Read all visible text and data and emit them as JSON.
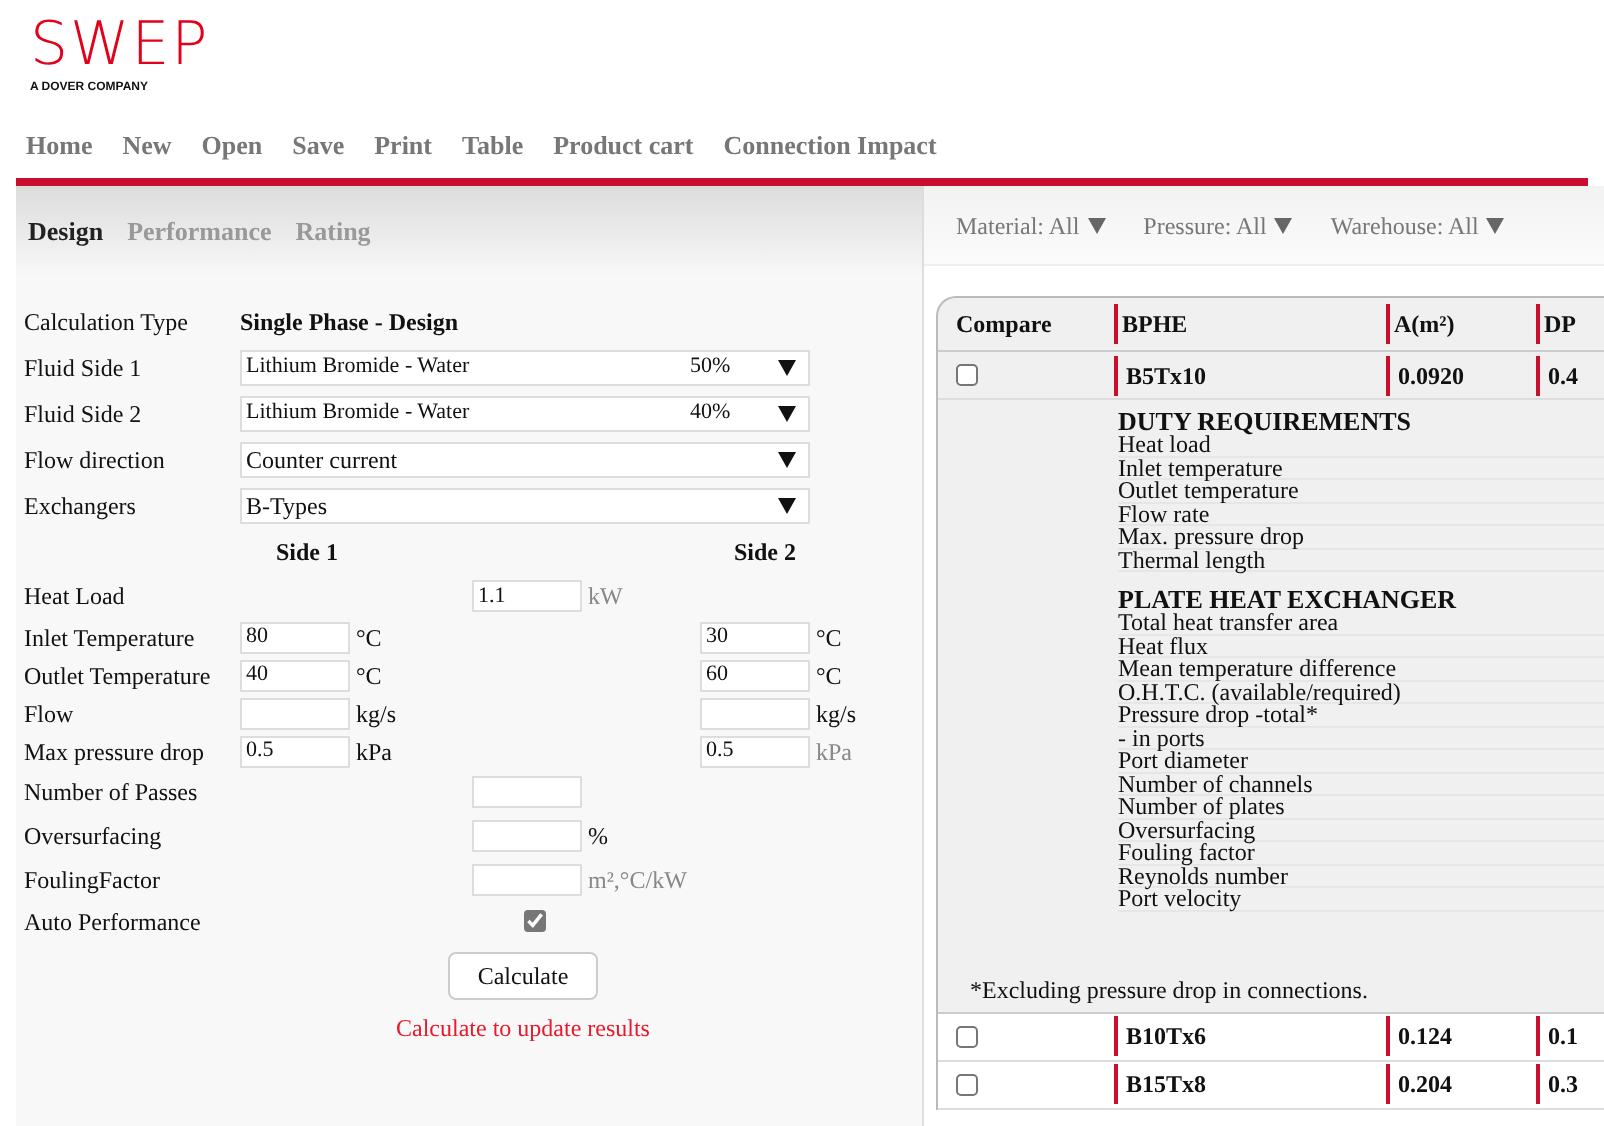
{
  "logo": {
    "name": "SWEP",
    "tagline": "A DOVER COMPANY"
  },
  "nav": [
    "Home",
    "New",
    "Open",
    "Save",
    "Print",
    "Table",
    "Product cart",
    "Connection Impact"
  ],
  "design_tabs": [
    {
      "label": "Design",
      "selected": true
    },
    {
      "label": "Performance",
      "selected": false
    },
    {
      "label": "Rating",
      "selected": false
    }
  ],
  "filters": [
    {
      "label": "Material:",
      "value": "All"
    },
    {
      "label": "Pressure:",
      "value": "All"
    },
    {
      "label": "Warehouse:",
      "value": "All"
    }
  ],
  "form": {
    "calculation_type": {
      "label": "Calculation Type",
      "value": "Single Phase - Design"
    },
    "selects": [
      {
        "label": "Fluid Side 1",
        "value": "Lithium Bromide - Water",
        "extra": "50%"
      },
      {
        "label": "Fluid Side 2",
        "value": "Lithium Bromide - Water",
        "extra": "40%"
      },
      {
        "label": "Flow direction",
        "value": "Counter current"
      },
      {
        "label": "Exchangers",
        "value": "B-Types"
      }
    ],
    "side_headers": [
      "Side 1",
      "Side 2"
    ],
    "rows": [
      {
        "kind": "center",
        "label": "Heat Load",
        "value": "1.1",
        "unit": "kW",
        "unit_muted": true
      },
      {
        "kind": "sides",
        "label": "Inlet Temperature",
        "side_1": {
          "value": "80",
          "unit": "°C",
          "unit_muted": false
        },
        "side_2": {
          "value": "30",
          "unit": "°C",
          "unit_muted": false
        }
      },
      {
        "kind": "sides",
        "label": "Outlet Temperature",
        "side_1": {
          "value": "40",
          "unit": "°C",
          "unit_muted": false
        },
        "side_2": {
          "value": "60",
          "unit": "°C",
          "unit_muted": false
        }
      },
      {
        "kind": "sides",
        "label": "Flow",
        "side_1": {
          "unit": "kg/s",
          "unit_muted": false
        },
        "side_2": {
          "unit": "kg/s",
          "unit_muted": false
        }
      },
      {
        "kind": "sides",
        "label": "Max pressure drop",
        "side_1": {
          "value": "0.5",
          "unit": "kPa",
          "unit_muted": false
        },
        "side_2": {
          "value": "0.5",
          "unit": "kPa",
          "unit_muted": true
        }
      },
      {
        "kind": "center",
        "label": "Number of Passes"
      },
      {
        "kind": "center",
        "label": "Oversurfacing",
        "unit": "%",
        "unit_muted": false
      },
      {
        "kind": "center",
        "label": "FoulingFactor",
        "unit": "m²,°C/kW",
        "unit_muted": true
      },
      {
        "kind": "checkbox",
        "label": "Auto Performance",
        "checked": true
      }
    ],
    "button": "Calculate",
    "message": "Calculate to update results"
  },
  "table": {
    "columns": [
      "Compare",
      "BPHE",
      "A(m²)",
      "DP"
    ],
    "rows": [
      {
        "checked": false,
        "bphe": "B5Tx10",
        "area": "0.0920",
        "dp": "0.4",
        "expanded": true
      },
      {
        "checked": false,
        "bphe": "B10Tx6",
        "area": "0.124",
        "dp": "0.1",
        "expanded": false
      },
      {
        "checked": false,
        "bphe": "B15Tx8",
        "area": "0.204",
        "dp": "0.3",
        "expanded": false
      }
    ],
    "details": {
      "sections": [
        {
          "title": "DUTY REQUIREMENTS",
          "items": [
            "Heat load",
            "Inlet temperature",
            "Outlet temperature",
            "Flow rate",
            "Max. pressure drop",
            "Thermal length"
          ]
        },
        {
          "title": "PLATE HEAT EXCHANGER",
          "items": [
            "Total heat transfer area",
            "Heat flux",
            "Mean temperature difference",
            "O.H.T.C. (available/required)",
            "Pressure drop -total*",
            "- in ports",
            "Port diameter",
            "Number of channels",
            "Number of plates",
            "Oversurfacing",
            "Fouling factor",
            "Reynolds number",
            "Port velocity"
          ]
        }
      ],
      "footnote": "*Excluding pressure drop in connections."
    }
  }
}
